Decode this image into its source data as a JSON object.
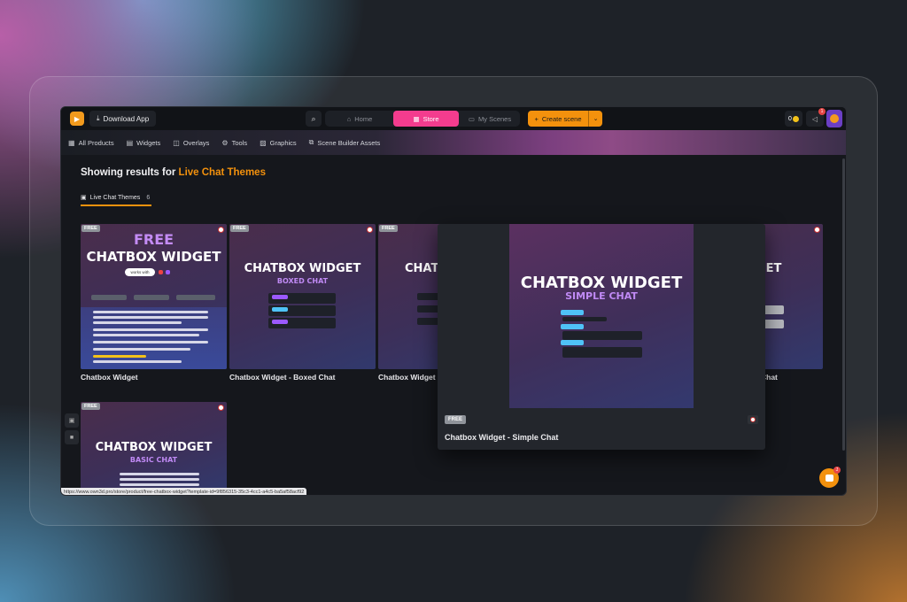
{
  "topbar": {
    "download_label": "Download App",
    "nav": [
      {
        "label": "Home",
        "icon": "home-icon",
        "active": false
      },
      {
        "label": "Store",
        "icon": "store-icon",
        "active": true
      },
      {
        "label": "My Scenes",
        "icon": "folder-icon",
        "active": false
      }
    ],
    "create_label": "Create scene",
    "tokens": "0",
    "notif_count": "1"
  },
  "subnav": [
    {
      "label": "All Products",
      "icon": "grid-icon"
    },
    {
      "label": "Widgets",
      "icon": "widget-icon"
    },
    {
      "label": "Overlays",
      "icon": "overlay-icon"
    },
    {
      "label": "Tools",
      "icon": "gear-icon"
    },
    {
      "label": "Graphics",
      "icon": "image-icon"
    },
    {
      "label": "Scene Builder Assets",
      "icon": "scene-icon"
    }
  ],
  "results": {
    "prefix": "Showing results for ",
    "query": "Live Chat Themes"
  },
  "filter_tab": {
    "label": "Live Chat Themes",
    "count": "6"
  },
  "cards": [
    {
      "title": "Chatbox Widget",
      "badge": "FREE",
      "big1": "FREE",
      "big2": "CHATBOX WIDGET",
      "tag": "works with"
    },
    {
      "title": "Chatbox Widget - Boxed Chat",
      "badge": "FREE",
      "big1": "CHATBOX WIDGET",
      "big2": "BOXED CHAT"
    },
    {
      "title": "Chatbox Widget",
      "badge": "FREE",
      "big1": "CHATB"
    },
    {
      "title": "Chat",
      "badge": "",
      "big1": "GET"
    },
    {
      "title": "",
      "badge": "FREE",
      "big1": "CHATBOX WIDGET",
      "big2": "BASIC CHAT"
    }
  ],
  "overlay": {
    "badge": "FREE",
    "title": "Chatbox Widget - Simple Chat",
    "big1": "CHATBOX WIDGET",
    "big2": "SIMPLE CHAT"
  },
  "status_url": "https://www.own3d.pro/store/product/free-chatbox-widget?template-id=9f856315-35c3-4cc1-a4c5-ba5af58acf92",
  "chat_badge": "1",
  "colors": {
    "accent": "#f3910d",
    "store": "#f43c8e"
  }
}
